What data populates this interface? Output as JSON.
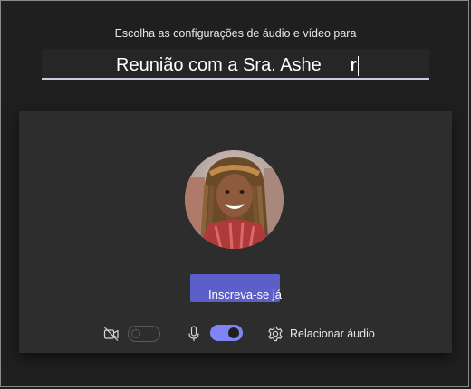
{
  "header": {
    "instruction": "Escolha as configurações de áudio e vídeo para"
  },
  "meeting": {
    "title": "Reunião com a Sra. Ashe",
    "caret_glyph": "r"
  },
  "preview": {
    "join_label": "Inscreva-se já",
    "camera": {
      "icon": "video-off-icon",
      "enabled": false
    },
    "microphone": {
      "icon": "microphone-icon",
      "enabled": true
    },
    "audio_settings_label": "Relacionar áudio",
    "audio_settings_icon": "gear-icon"
  },
  "colors": {
    "background": "#1f1f1f",
    "panel": "#2d2d2d",
    "accent": "#5b5fc7",
    "toggle_on": "#7f85f5"
  }
}
